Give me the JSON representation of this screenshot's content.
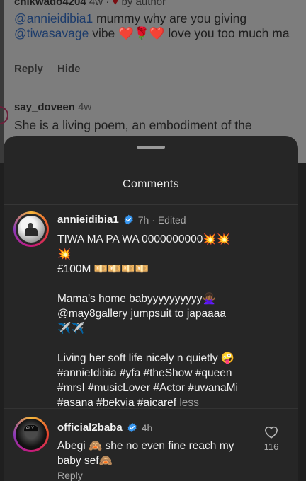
{
  "background_comments": {
    "first": {
      "username": "chikwado4204",
      "time": "4w",
      "heart": "♥",
      "by_author": "by author",
      "mention1": "@annieidibia1",
      "text_a": " mummy why are you giving ",
      "mention2": "@tiwasavage",
      "text_b": " vibe ",
      "emojis": "❤️🌹❤️",
      "text_c": " love you too much ma",
      "reply_label": "Reply",
      "hide_label": "Hide"
    },
    "second": {
      "username": "say_doveen",
      "time": "4w",
      "text": "She is a living poem, an embodiment of the"
    }
  },
  "sheet": {
    "title": "Comments"
  },
  "caption": {
    "username": "annieidibia1",
    "time": "7h",
    "edited": "· Edited",
    "line1": "TIWA MA PA WA 0000000000💥💥",
    "line2": "💥",
    "line3": "£100M 💴💴💴💴",
    "line4": "Mama's home babyyyyyyyyyy🙅🏾‍♀️",
    "line5": " @may8gallery jumpsuit  to  japaaaa",
    "line6": "✈️✈️",
    "line7": "Living her soft life nicely n quietly 🤪",
    "line8": "#annieIdibia #yfa #theShow #queen",
    "line9": "#mrsI #musicLover #Actor #uwanaMi",
    "line10": "#asana #bekvia #aicaref",
    "less": " less"
  },
  "reply_comment": {
    "username": "official2baba",
    "time": "4h",
    "text": "Abegi 🙈 she no even fine reach my baby sef🙈",
    "reply_label": "Reply",
    "like_count": "116"
  },
  "colors": {
    "sheet_bg": "#262626",
    "verified": "#3897f0",
    "story_ring": "#c5197d"
  },
  "icons": {
    "verified": "verified-badge-icon",
    "like": "heart-outline-icon"
  }
}
